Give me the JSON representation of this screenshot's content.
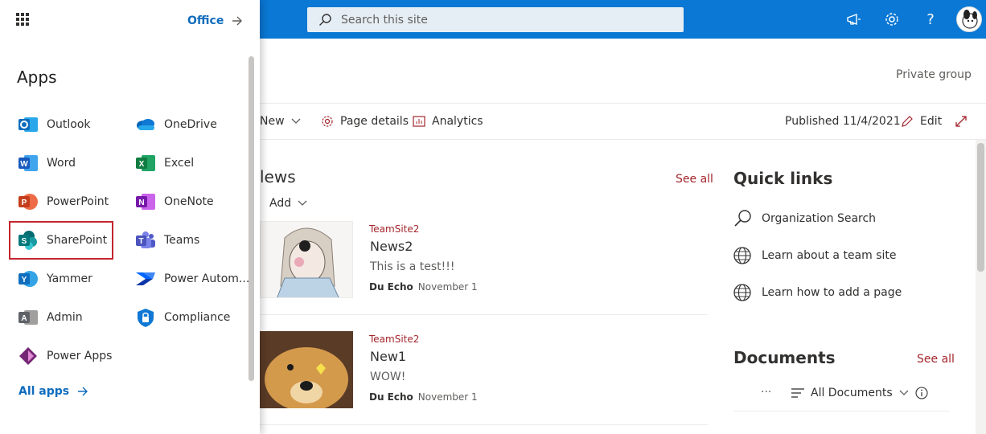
{
  "search": {
    "placeholder": "Search this site"
  },
  "topbar": {
    "icons": [
      "megaphone-icon",
      "gear-icon",
      "help-icon",
      "avatar"
    ]
  },
  "site": {
    "privacy": "Private group"
  },
  "commandbar": {
    "new": "New",
    "page_details": "Page details",
    "analytics": "Analytics",
    "published": "Published 11/4/2021",
    "edit": "Edit"
  },
  "news": {
    "title": "News",
    "title_visible": "lews",
    "see_all": "See all",
    "add": "Add",
    "items": [
      {
        "site": "TeamSite2",
        "title": "News2",
        "desc": "This is a test!!!",
        "author": "Du Echo",
        "date": "November 1"
      },
      {
        "site": "TeamSite2",
        "title": "New1",
        "desc": "WOW!",
        "author": "Du Echo",
        "date": "November 1"
      }
    ]
  },
  "quicklinks": {
    "title": "Quick links",
    "items": [
      {
        "label": "Organization Search",
        "icon": "search-icon"
      },
      {
        "label": "Learn about a team site",
        "icon": "globe-icon"
      },
      {
        "label": "Learn how to add a page",
        "icon": "globe-icon"
      }
    ]
  },
  "documents": {
    "title": "Documents",
    "see_all": "See all",
    "view": "All Documents",
    "more": "···"
  },
  "launcher": {
    "office": "Office",
    "title": "Apps",
    "all_apps": "All apps",
    "apps": [
      {
        "label": "Outlook",
        "color": "#0f6cbd"
      },
      {
        "label": "OneDrive",
        "color": "#0f78d4"
      },
      {
        "label": "Word",
        "color": "#185abd"
      },
      {
        "label": "Excel",
        "color": "#107c41"
      },
      {
        "label": "PowerPoint",
        "color": "#c43e1c"
      },
      {
        "label": "OneNote",
        "color": "#7719aa"
      },
      {
        "label": "SharePoint",
        "color": "#036c70"
      },
      {
        "label": "Teams",
        "color": "#5059c9"
      },
      {
        "label": "Yammer",
        "color": "#106ebe"
      },
      {
        "label": "Power Autom...",
        "color": "#0066ff"
      },
      {
        "label": "Admin",
        "color": "#5f6368"
      },
      {
        "label": "Compliance",
        "color": "#0f78d4"
      },
      {
        "label": "Power Apps",
        "color": "#742774"
      }
    ]
  }
}
